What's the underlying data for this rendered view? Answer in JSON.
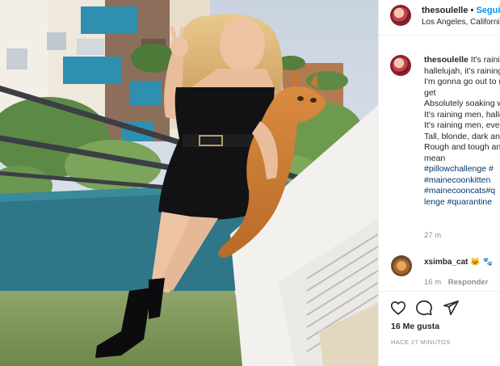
{
  "post": {
    "username": "thesoulelle",
    "separator": "•",
    "follow_label": "Seguir",
    "location": "Los Angeles, California",
    "avatar_icon": "profile-avatar"
  },
  "caption": {
    "username": "thesoulelle",
    "lines": [
      "It's raining men",
      "hallelujah, it's raining men",
      "I'm gonna go out to run and let myself",
      "get",
      "Absolutely soaking wet",
      "It's raining men, hallelujah",
      "It's raining men, every specimen",
      "Tall, blonde, dark and lean",
      "Rough and tough and strong and",
      "mean"
    ],
    "hashtags": [
      "#pillowchallenge",
      "#",
      "#mainecoonkitten",
      "#mainecooncats",
      "#q",
      "lenge",
      "#quarantine"
    ],
    "time": "27 m"
  },
  "comment": {
    "username": "xsimba_cat",
    "text": "🐱 🐾",
    "time": "16 m",
    "reply_label": "Responder"
  },
  "actions": {
    "like_icon": "heart-icon",
    "comment_icon": "comment-icon",
    "share_icon": "share-icon",
    "likes": "16 Me gusta",
    "posted_ago": "HACE 27 MINUTOS"
  },
  "colors": {
    "link": "#0095f6",
    "hashtag": "#00376b",
    "muted": "#8e8e8e",
    "border": "#efefef"
  }
}
